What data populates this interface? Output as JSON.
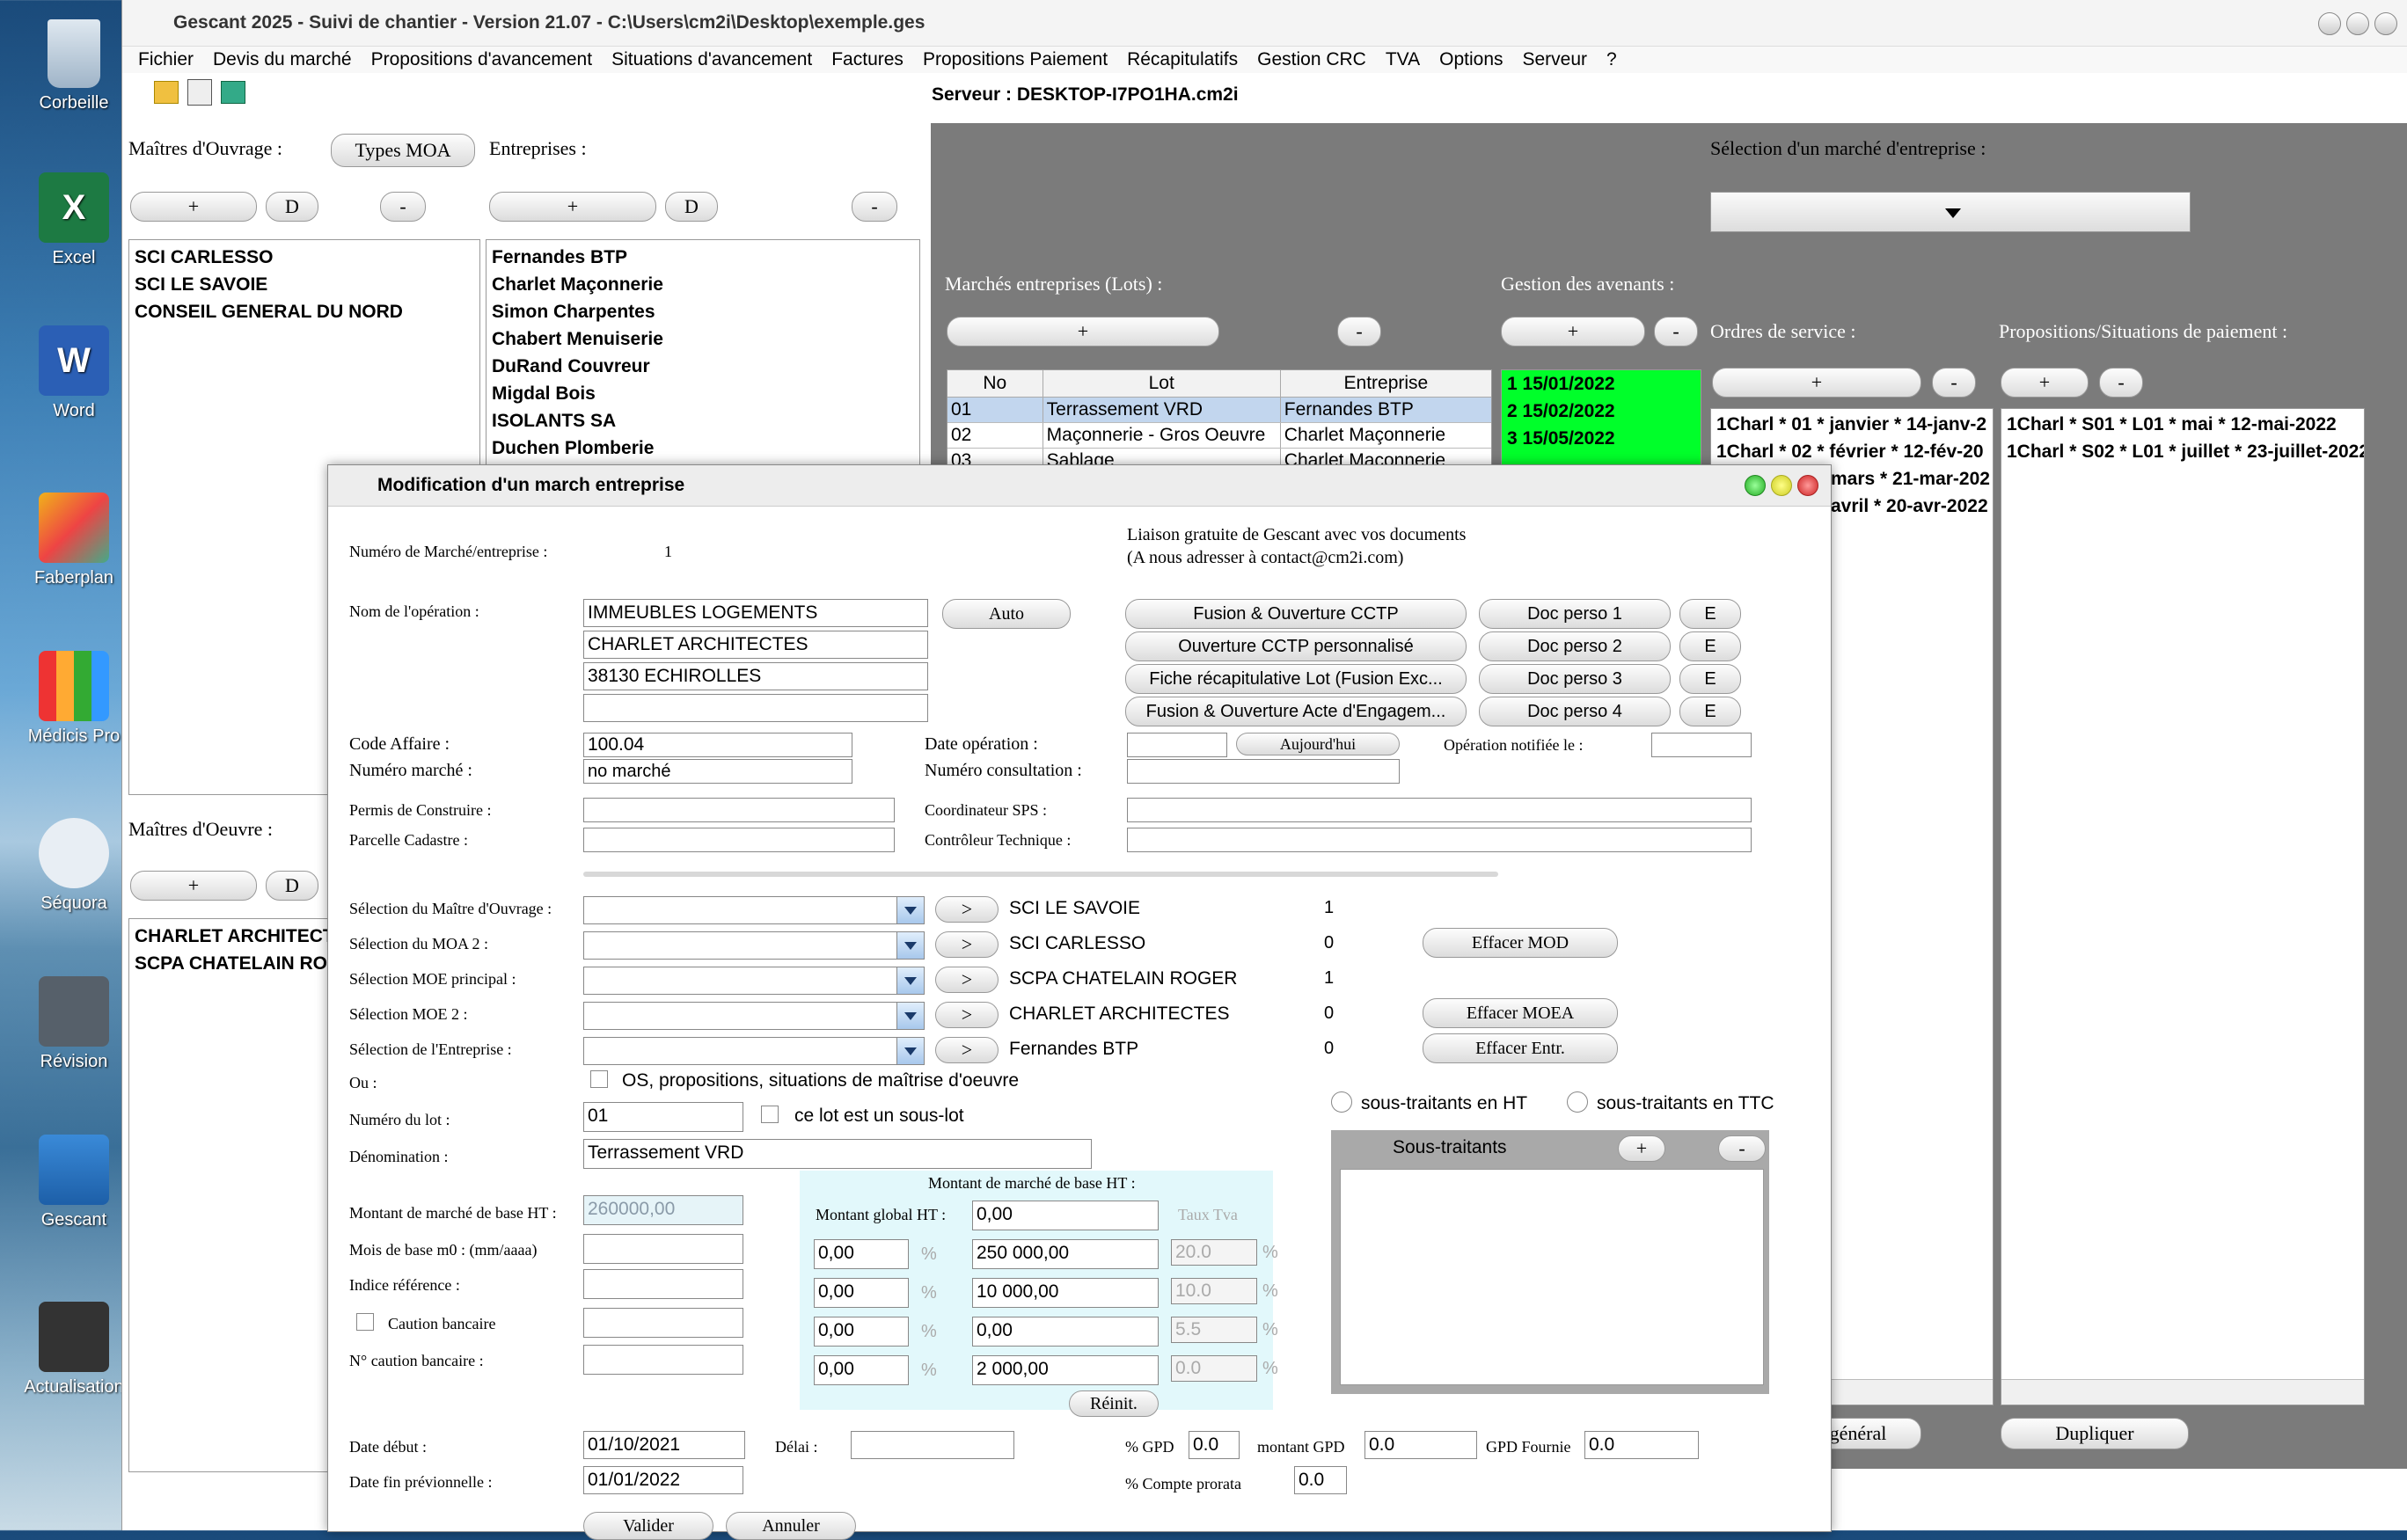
{
  "desktop": {
    "icons": [
      "Corbeille",
      "Excel",
      "Word",
      "Faberplan",
      "Médicis Pro",
      "Séquora",
      "Révision",
      "Gescant",
      "Actualisation"
    ]
  },
  "window": {
    "title": "Gescant 2025 - Suivi de chantier - Version 21.07 - C:\\Users\\cm2i\\Desktop\\exemple.ges"
  },
  "menu": [
    "Fichier",
    "Devis du marché",
    "Propositions d'avancement",
    "Situations d'avancement",
    "Factures",
    "Propositions Paiement",
    "Récapitulatifs",
    "Gestion CRC",
    "TVA",
    "Options",
    "Serveur",
    "?"
  ],
  "server": "Serveur : DESKTOP-I7PO1HA.cm2i",
  "left": {
    "moa_label": "Maîtres d'Ouvrage :",
    "types_moa": "Types MOA",
    "entreprises_label": "Entreprises :",
    "plus": "+",
    "d": "D",
    "minus": "-",
    "moa": [
      "SCI CARLESSO",
      "SCI LE SAVOIE",
      "CONSEIL GENERAL DU NORD"
    ],
    "entreprises": [
      "Fernandes BTP",
      "Charlet Maçonnerie",
      "Simon Charpentes",
      "Chabert Menuiserie",
      "DuRand Couvreur",
      "Migdal Bois",
      "ISOLANTS SA",
      "Duchen Plomberie"
    ],
    "moe_label": "Maîtres d'Oeuvre :",
    "moe": [
      "CHARLET ARCHITECT",
      "SCPA CHATELAIN RO"
    ]
  },
  "right": {
    "selection_label": "Sélection d'un marché d'entreprise :",
    "marches_label": "Marchés entreprises (Lots) :",
    "avenants_label": "Gestion des avenants :",
    "os_label": "Ordres de service :",
    "prop_label": "Propositions/Situations de paiement :",
    "lots_headers": [
      "No",
      "Lot",
      "Entreprise"
    ],
    "lots": [
      [
        "01",
        "Terrassement VRD",
        "Fernandes BTP"
      ],
      [
        "02",
        "Maçonnerie - Gros Oeuvre",
        "Charlet Maçonnerie"
      ],
      [
        "03",
        "Sablage",
        "Charlet Maçonnerie"
      ]
    ],
    "avenants": [
      "1 15/01/2022",
      "2 15/02/2022",
      "3 15/05/2022"
    ],
    "os": [
      "1Charl * 01 * janvier * 14-janv-2",
      "1Charl * 02 * février * 12-fév-20",
      "mars * 21-mar-202",
      "avril * 20-avr-2022"
    ],
    "props": [
      "1Charl * S01 * L01 * mai * 12-mai-2022",
      "1Charl * S02 * L01 * juillet * 23-juillet-2022"
    ],
    "general": "général",
    "dupliquer": "Dupliquer"
  },
  "dialog": {
    "title": "Modification d'un march  entreprise",
    "num_label": "Numéro de Marché/entreprise :",
    "num_value": "1",
    "liaison1": "Liaison gratuite de Gescant avec vos documents",
    "liaison2": "(A nous adresser à contact@cm2i.com)",
    "nom_label": "Nom de l'opération :",
    "nom": [
      "IMMEUBLES LOGEMENTS",
      "CHARLET ARCHITECTES",
      "38130 ECHIROLLES",
      ""
    ],
    "auto": "Auto",
    "docs": [
      "Fusion & Ouverture CCTP",
      "Ouverture CCTP personnalisé",
      "Fiche récapitulative Lot (Fusion Exc...",
      "Fusion & Ouverture Acte d'Engagem..."
    ],
    "perso": [
      "Doc perso 1",
      "Doc perso 2",
      "Doc perso 3",
      "Doc perso 4"
    ],
    "e": "E",
    "code_label": "Code Affaire  :",
    "code": "100.04",
    "nummarche_label": "Numéro marché :",
    "nummarche": "no marché",
    "dateop_label": "Date opération :",
    "aujourdhui": "Aujourd'hui",
    "notifiee_label": "Opération notifiée le :",
    "consult_label": "Numéro consultation :",
    "permis_label": "Permis de Construire :",
    "parcelle_label": "Parcelle Cadastre :",
    "sps_label": "Coordinateur SPS :",
    "ctrl_label": "Contrôleur Technique :",
    "sel_rows": [
      {
        "label": "Sélection du Maître d'Ouvrage :",
        "name": "SCI LE SAVOIE",
        "n": "1"
      },
      {
        "label": "Sélection du MOA 2 :",
        "name": "SCI CARLESSO",
        "n": "0"
      },
      {
        "label": "Sélection MOE principal :",
        "name": "SCPA CHATELAIN ROGER",
        "n": "1"
      },
      {
        "label": "Sélection MOE 2 :",
        "name": "CHARLET ARCHITECTES",
        "n": "0"
      },
      {
        "label": "Sélection de l'Entreprise :",
        "name": "Fernandes BTP",
        "n": "0"
      }
    ],
    "go": ">",
    "effacer_mod": "Effacer MOD",
    "effacer_moea": "Effacer MOEA",
    "effacer_entr": "Effacer Entr.",
    "ou_label": "Ou :",
    "os_check": "OS, propositions, situations de maîtrise d'oeuvre",
    "numlot_label": "Numéro du lot :",
    "numlot": "01",
    "souslot": "ce lot est un sous-lot",
    "denom_label": "Dénomination :",
    "denom": "Terrassement VRD",
    "st_ht": "sous-traitants en HT",
    "st_ttc": "sous-traitants en TTC",
    "soustraitants": "Sous-traitants",
    "montant_label": "Montant de marché de base HT :",
    "montant": "260000,00",
    "mois_label": "Mois de base m0 : (mm/aaaa)",
    "indice_label": "Indice référence :",
    "caution_label": "Caution bancaire",
    "ncaution_label": "N° caution bancaire :",
    "panel_title": "Montant de marché de base HT :",
    "global_label": "Montant global HT :",
    "global": "0,00",
    "taux": "Taux Tva",
    "rows": [
      [
        "0,00",
        "250 000,00",
        "20.0"
      ],
      [
        "0,00",
        "10 000,00",
        "10.0"
      ],
      [
        "0,00",
        "0,00",
        "5.5"
      ],
      [
        "0,00",
        "2 000,00",
        "0.0"
      ]
    ],
    "pct": "%",
    "reinit": "Réinit.",
    "debut_label": "Date début :",
    "debut": "01/10/2021",
    "delai_label": "Délai :",
    "fin_label": "Date fin prévionnelle :",
    "fin": "01/01/2022",
    "gpd_label": "% GPD",
    "gpd": "0.0",
    "mgpd_label": "montant GPD",
    "mgpd": "0.0",
    "gpdf_label": "GPD Fournie",
    "gpdf": "0.0",
    "prorata_label": "% Compte prorata",
    "prorata": "0.0",
    "valider": "Valider",
    "annuler": "Annuler"
  }
}
